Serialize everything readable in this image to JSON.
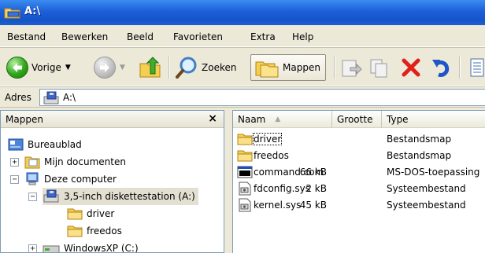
{
  "window": {
    "title": "A:\\"
  },
  "menu": {
    "items": [
      "Bestand",
      "Bewerken",
      "Beeld",
      "Favorieten",
      "Extra",
      "Help"
    ]
  },
  "toolbar": {
    "back_label": "Vorige",
    "search_label": "Zoeken",
    "folders_label": "Mappen"
  },
  "address": {
    "label": "Adres",
    "value": "A:\\"
  },
  "folders_pane": {
    "title": "Mappen",
    "close_glyph": "×",
    "tree": [
      {
        "label": "Bureaublad",
        "icon": "desktop-icon",
        "expander": ""
      },
      {
        "label": "Mijn documenten",
        "icon": "my-documents-icon",
        "expander": "+"
      },
      {
        "label": "Deze computer",
        "icon": "my-computer-icon",
        "expander": "−"
      },
      {
        "label": "3,5-inch diskettestation (A:)",
        "icon": "floppy-drive-icon",
        "expander": "−"
      },
      {
        "label": "driver",
        "icon": "folder-icon",
        "expander": ""
      },
      {
        "label": "freedos",
        "icon": "folder-icon",
        "expander": ""
      },
      {
        "label": "WindowsXP (C:)",
        "icon": "hard-drive-icon",
        "expander": "+"
      }
    ]
  },
  "files_pane": {
    "columns": {
      "name": "Naam",
      "size": "Grootte",
      "type": "Type"
    },
    "sort_indicator": "▲",
    "files": [
      {
        "name": "driver",
        "size": "",
        "type": "Bestandsmap",
        "icon": "folder-icon"
      },
      {
        "name": "freedos",
        "size": "",
        "type": "Bestandsmap",
        "icon": "folder-icon"
      },
      {
        "name": "command.com",
        "size": "66 kB",
        "type": "MS-DOS-toepassing",
        "icon": "dos-app-icon"
      },
      {
        "name": "fdconfig.sys",
        "size": "2 kB",
        "type": "Systeembestand",
        "icon": "system-file-icon"
      },
      {
        "name": "kernel.sys",
        "size": "45 kB",
        "type": "Systeembestand",
        "icon": "system-file-icon"
      }
    ]
  },
  "colors": {
    "titlebar": "#1c5fd8",
    "chrome": "#ece9d8",
    "delete_red": "#e0201b",
    "folder_yellow": "#f5c842"
  }
}
